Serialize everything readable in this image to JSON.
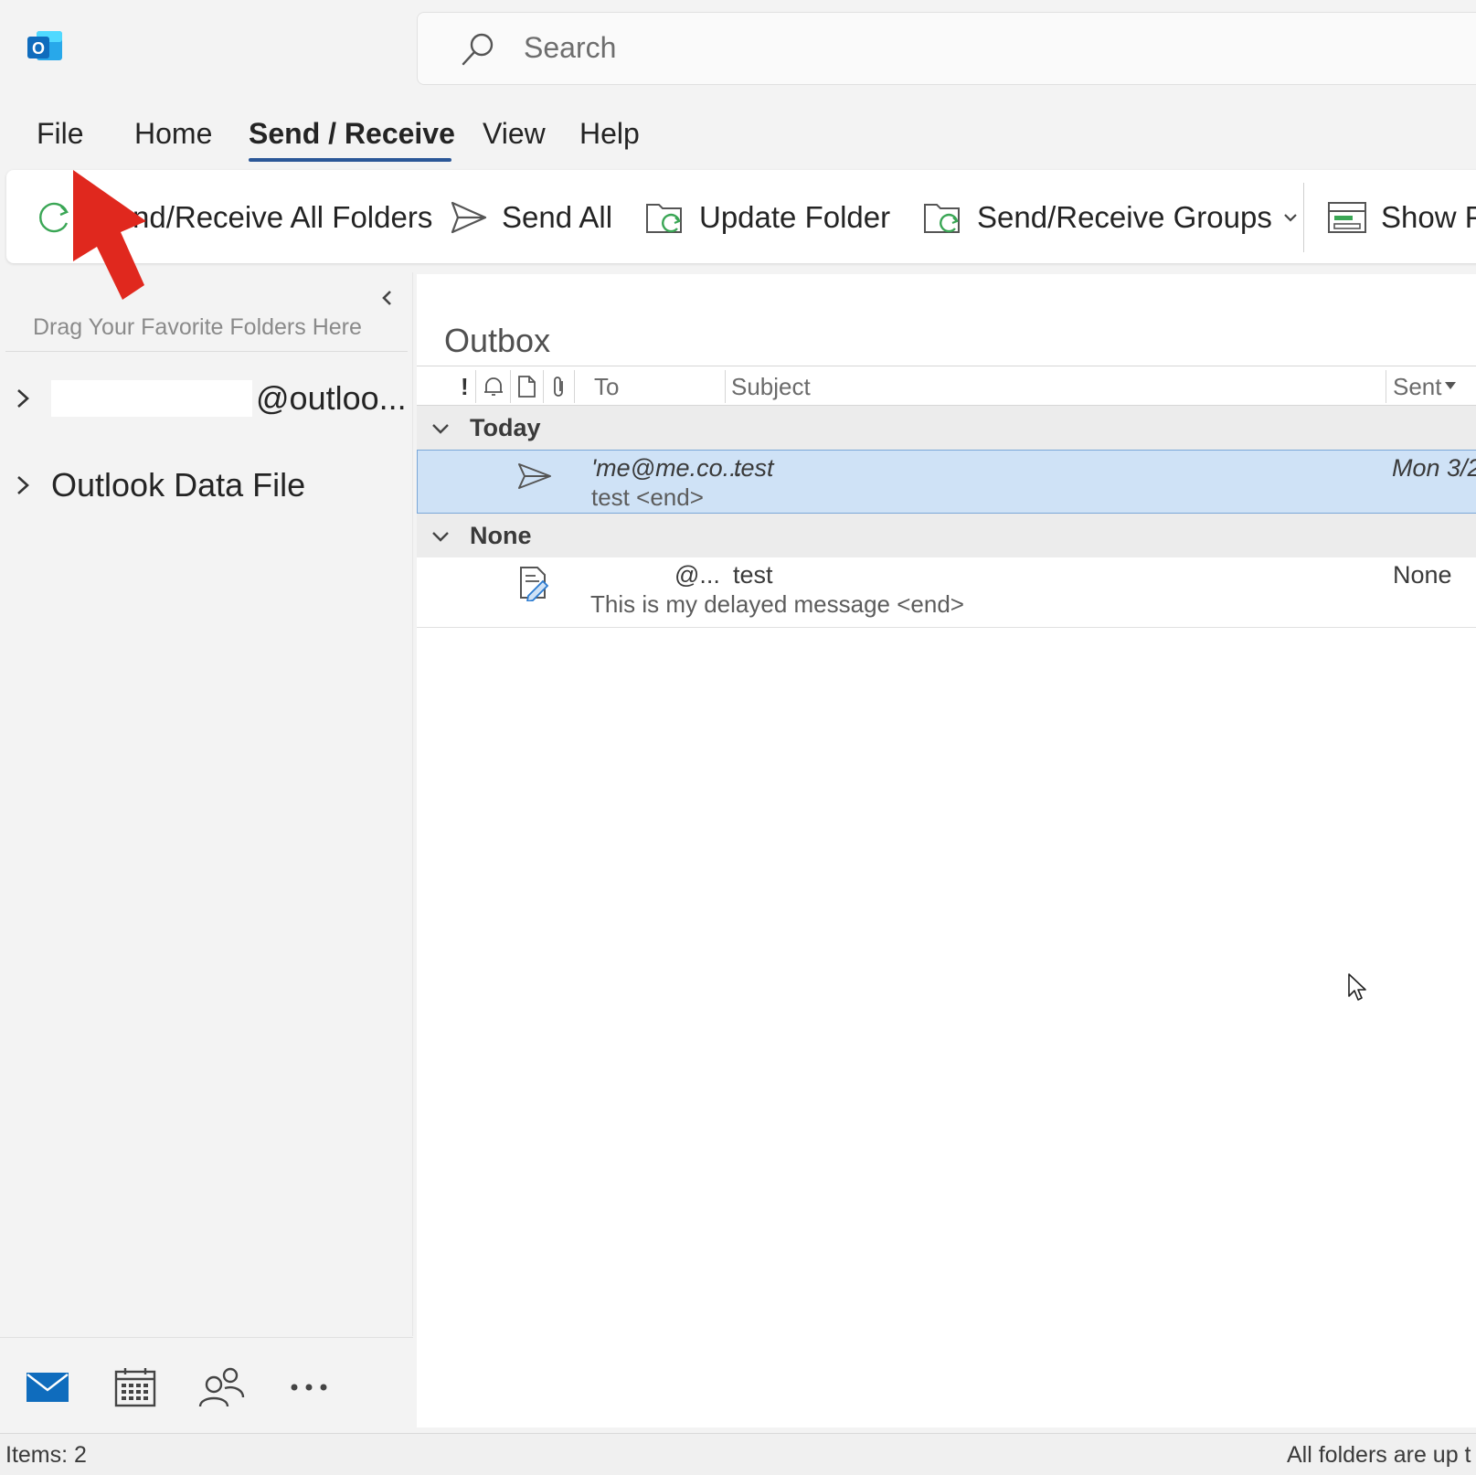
{
  "colors": {
    "accent": "#2b5797",
    "selection": "#cfe2f6",
    "annotation_arrow": "#e0281e",
    "outlook_blue": "#0f6cbd"
  },
  "app": {
    "logo_icon": "outlook-logo-icon",
    "logo_letter": "O"
  },
  "search": {
    "placeholder": "Search",
    "icon": "search-icon"
  },
  "menu": {
    "tabs": [
      {
        "label": "File"
      },
      {
        "label": "Home"
      },
      {
        "label": "Send / Receive",
        "active": true
      },
      {
        "label": "View"
      },
      {
        "label": "Help"
      }
    ]
  },
  "ribbon": {
    "buttons": [
      {
        "label": "Send/Receive All Folders",
        "visible_text": "nd/Receive All Folders",
        "icon": "sync-icon"
      },
      {
        "label": "Send All",
        "icon": "send-icon"
      },
      {
        "label": "Update Folder",
        "icon": "update-folder-icon"
      },
      {
        "label": "Send/Receive Groups",
        "icon": "send-receive-groups-icon",
        "dropdown": true
      },
      {
        "label": "Show P",
        "icon": "show-progress-icon"
      }
    ]
  },
  "annotation": {
    "arrow": "red-arrow-pointing-to-file"
  },
  "folder_pane": {
    "favorites_hint": "Drag Your Favorite Folders Here",
    "accounts": [
      {
        "label": "@outloo...",
        "redacted_prefix": true
      },
      {
        "label": "Outlook Data File"
      }
    ]
  },
  "nav": {
    "items": [
      {
        "name": "mail-icon",
        "active": true
      },
      {
        "name": "calendar-icon"
      },
      {
        "name": "people-icon"
      },
      {
        "name": "more-icon",
        "label": "..."
      }
    ]
  },
  "message_list": {
    "folder_name": "Outbox",
    "columns": {
      "importance": "!",
      "to": "To",
      "subject": "Subject",
      "sent": "Sent"
    },
    "groups": [
      {
        "label": "Today",
        "messages": [
          {
            "to": "'me@me.co...",
            "subject": "test",
            "preview": "test <end>",
            "sent": "Mon 3/2",
            "icon": "sending-icon",
            "selected": true
          }
        ]
      },
      {
        "label": "None",
        "messages": [
          {
            "to": "@...",
            "subject": "test",
            "preview": "This is my delayed message <end>",
            "sent": "None",
            "icon": "draft-icon",
            "selected": false
          }
        ]
      }
    ]
  },
  "status_bar": {
    "items": "Items: 2",
    "right": "All folders are up t"
  }
}
